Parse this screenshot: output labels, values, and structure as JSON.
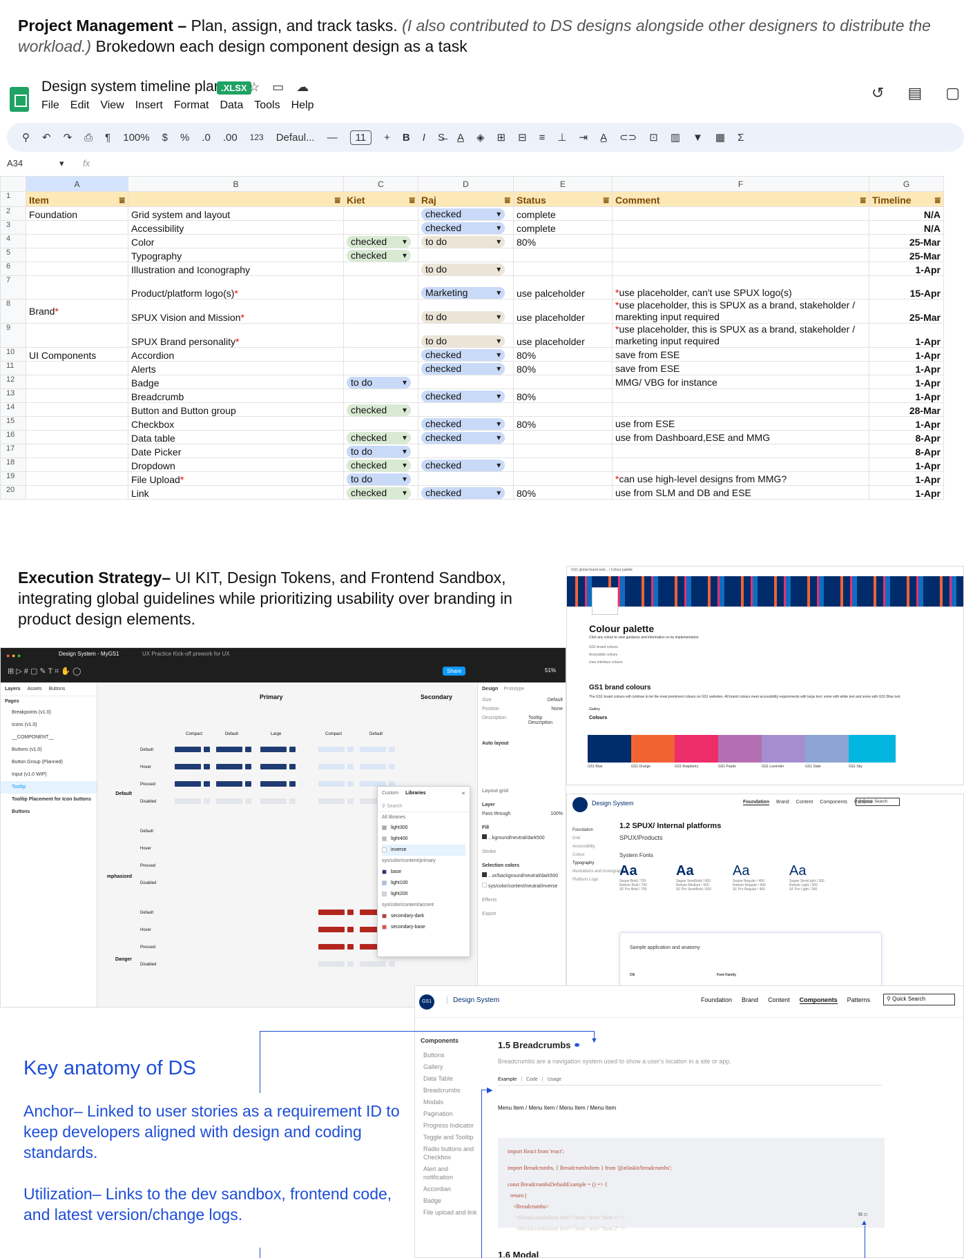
{
  "intro": {
    "bold": "Project Management –",
    "text": " Plan, assign, and track tasks. ",
    "italic": "(I also contributed to DS designs alongside other designers to distribute the workload.)",
    "tail": " Brokedown each design component design as a task"
  },
  "sheet": {
    "title": "Design system timeline plan",
    "badge": ".XLSX",
    "menu": [
      "File",
      "Edit",
      "View",
      "Insert",
      "Format",
      "Data",
      "Tools",
      "Help"
    ],
    "toolbar": {
      "zoom": "100%",
      "currency": "$",
      "percent": "%",
      "dec_dec": ".0",
      "dec_inc": ".00",
      "fmt": "123",
      "font": "Defaul...",
      "font_size": "11",
      "bold": "B",
      "italic": "I"
    },
    "cell_ref": "A34",
    "fx": "fx",
    "columns": [
      "A",
      "B",
      "C",
      "D",
      "E",
      "F",
      "G"
    ],
    "headers": [
      "Item",
      "",
      "Kiet",
      "Raj",
      "Status",
      "Comment",
      "Timeline"
    ],
    "rows": [
      {
        "n": "2",
        "a": "Foundation",
        "b": "Grid system and layout",
        "c": "",
        "d": "checked",
        "e": "complete",
        "f": "",
        "g": "N/A"
      },
      {
        "n": "3",
        "a": "",
        "b": "Accessibility",
        "c": "",
        "d": "checked",
        "e": "complete",
        "f": "",
        "g": "N/A"
      },
      {
        "n": "4",
        "a": "",
        "b": "Color",
        "c": "checked",
        "d": "to do",
        "e": "80%",
        "f": "",
        "g": "25-Mar"
      },
      {
        "n": "5",
        "a": "",
        "b": "Typography",
        "c": "checked",
        "d": "",
        "e": "",
        "f": "",
        "g": "25-Mar"
      },
      {
        "n": "6",
        "a": "",
        "b": "Illustration and Iconography",
        "c": "",
        "d": "to do",
        "e": "",
        "f": "",
        "g": "1-Apr"
      },
      {
        "n": "7",
        "a": "",
        "b": "Product/platform logo(s)",
        "c": "",
        "d": "Marketing",
        "e": "use palceholder",
        "f": "use placeholder, can't use SPUX logo(s)",
        "g": "15-Apr"
      },
      {
        "n": "8",
        "a": "Brand",
        "b": "SPUX Vision and Mission",
        "c": "",
        "d": "to do",
        "e": "use placeholder",
        "f": "use placeholder, this is SPUX as a brand, stakeholder / marekting input required",
        "g": "25-Mar"
      },
      {
        "n": "9",
        "a": "",
        "b": "SPUX Brand personality",
        "c": "",
        "d": "to do",
        "e": "use placeholder",
        "f": "use placeholder, this is SPUX as a brand, stakeholder / marketing input required",
        "g": "1-Apr"
      },
      {
        "n": "10",
        "a": "UI Components",
        "b": "Accordion",
        "c": "",
        "d": "checked",
        "e": "80%",
        "f": "save from ESE",
        "g": "1-Apr"
      },
      {
        "n": "11",
        "a": "",
        "b": "Alerts",
        "c": "",
        "d": "checked",
        "e": "80%",
        "f": "save from ESE",
        "g": "1-Apr"
      },
      {
        "n": "12",
        "a": "",
        "b": "Badge",
        "c": "to do",
        "d": "",
        "e": "",
        "f": "MMG/ VBG for instance",
        "g": "1-Apr"
      },
      {
        "n": "13",
        "a": "",
        "b": "Breadcrumb",
        "c": "",
        "d": "checked",
        "e": "80%",
        "f": "",
        "g": "1-Apr"
      },
      {
        "n": "14",
        "a": "",
        "b": "Button and Button group",
        "c": "checked",
        "d": "",
        "e": "",
        "f": "",
        "g": "28-Mar"
      },
      {
        "n": "15",
        "a": "",
        "b": "Checkbox",
        "c": "",
        "d": "checked",
        "e": "80%",
        "f": "use from ESE",
        "g": "1-Apr"
      },
      {
        "n": "16",
        "a": "",
        "b": "Data table",
        "c": "checked",
        "d": "checked",
        "e": "",
        "f": "use from Dashboard,ESE and MMG",
        "g": "8-Apr"
      },
      {
        "n": "17",
        "a": "",
        "b": "Date Picker",
        "c": "to do",
        "d": "",
        "e": "",
        "f": "",
        "g": "8-Apr"
      },
      {
        "n": "18",
        "a": "",
        "b": "Dropdown",
        "c": "checked",
        "d": "checked",
        "e": "",
        "f": "",
        "g": "1-Apr"
      },
      {
        "n": "19",
        "a": "",
        "b": "File Upload",
        "c": "to do",
        "d": "",
        "e": "",
        "f": "can use high-level designs from MMG?",
        "g": "1-Apr"
      },
      {
        "n": "20",
        "a": "",
        "b": "Link",
        "c": "checked",
        "d": "checked",
        "e": "80%",
        "f": "use from SLM and DB and ESE",
        "g": "1-Apr"
      }
    ]
  },
  "exec": {
    "bold": "Execution Strategy–",
    "text": " UI KIT, Design Tokens, and Frontend Sandbox, integrating global guidelines while prioritizing usability over branding in product design elements."
  },
  "figma": {
    "tab1": "Design System - MyGS1",
    "tab2": "UX Practice Kick-off prework for UX",
    "share": "Share",
    "zoom": "51%",
    "layers_tabs": [
      "Layers",
      "Assets",
      "Buttons"
    ],
    "pages_label": "Pages",
    "pages": [
      "Breakpoints (v1.0)",
      "Icons (v1.0)",
      "__COMPONENT__",
      "Buttons (v1.0)",
      "Button Group (Planned)",
      "Input (v1.0 WIP)",
      "Tooltip",
      "Tooltip Placement for Icon buttons",
      "Buttons"
    ],
    "primary": "Primary",
    "secondary": "Secondary",
    "sizes": [
      "Compact",
      "Default",
      "Large",
      "Compact",
      "Default"
    ],
    "groups": [
      "Default",
      "mphasized",
      "Danger"
    ],
    "states": [
      "Default",
      "Hover",
      "Pressed",
      "Disabled"
    ],
    "right_tabs": [
      "Design",
      "Prototype"
    ],
    "right_labels": [
      "Size",
      "Position",
      "Description",
      "Auto layout",
      "Layout grid",
      "Layer",
      "Pass through",
      "100%",
      "Fill",
      "...kground/neutral/dark500",
      "Stroke",
      "Selection colors",
      "...or/background/neutral/dark500",
      "sys/color/content/neutral/inverse",
      "Effects",
      "Export"
    ],
    "size_val": "Default",
    "position_val": "None",
    "desc_val": "Tooltip Description",
    "pop": {
      "tabs": [
        "Custom",
        "Libraries"
      ],
      "search": "Search",
      "all": "All libraries",
      "items": [
        "light300",
        "light400",
        "inverse",
        "sys/color/content/primary",
        "base",
        "light100",
        "light200",
        "sys/color/content/accent",
        "secondary-dark",
        "secondary-base"
      ]
    }
  },
  "palette": {
    "breadcrumb": "GS1 global brand web... / Colour palette",
    "title": "Colour palette",
    "desc": "Click any colour to view guidance and information on its implementation.",
    "links": [
      "GS1 brand colours",
      "Accessible colours",
      "User interface colours"
    ],
    "section": "GS1 brand colours",
    "section_desc": "The GS1 brand colours will continue to be the most prominent colours on GS1 websites. All brand colours meet accessibility requirements with large text: some with white text and some with GS1 Blue text.",
    "gallery": "Gallery",
    "colours_label": "Colours",
    "swatches": [
      {
        "name": "GS1 Blue",
        "color": "#002c6c"
      },
      {
        "name": "GS1 Orange",
        "color": "#f26334"
      },
      {
        "name": "GS1 Raspberry",
        "color": "#ee2d6b"
      },
      {
        "name": "GS1 Purple",
        "color": "#b36fb1"
      },
      {
        "name": "GS1 Lavender",
        "color": "#a58ed0"
      },
      {
        "name": "GS1 Slate",
        "color": "#8da4d3"
      },
      {
        "name": "GS1 Sky",
        "color": "#00b6de"
      }
    ]
  },
  "spux": {
    "brand": "Design System",
    "nav": [
      "Foundation",
      "Brand",
      "Content",
      "Components",
      "Patterns"
    ],
    "search": "Quick Search",
    "side": [
      "Foundation",
      "Grid",
      "Accessibility",
      "Colour",
      "Typography",
      "Illustrations and Iconography",
      "Platform Logo"
    ],
    "heading": "1.2 SPUX/ Internal platforms",
    "sub": "SPUX/Products",
    "fonts_label": "System Fonts",
    "fonts": [
      {
        "aa": "Aa",
        "l1": "Segoe Bold / 700",
        "l2": "Roboto Bold / 700",
        "l3": "SF Pro Bold / 700"
      },
      {
        "aa": "Aa",
        "l1": "Segoe SemiBold / 600",
        "l2": "Roboto Medium / 500",
        "l3": "SF Pro SemiBold / 600"
      },
      {
        "aa": "Aa",
        "l1": "Segoe Regular / 400",
        "l2": "Roboto Regular / 400",
        "l3": "SF Pro Regular / 400"
      },
      {
        "aa": "Aa",
        "l1": "Segoe SemiLight / 300",
        "l2": "Roboto Light / 300",
        "l3": "SF Pro Light / 300"
      }
    ],
    "sample": "Sample application and anatomy",
    "os": "OS",
    "font_family": "Font Family"
  },
  "site": {
    "logo": "GS1",
    "brand": "Design System",
    "nav": [
      "Foundation",
      "Brand",
      "Content",
      "Components",
      "Patterns"
    ],
    "search": "Quick Search",
    "side_title": "Components",
    "side": [
      "Buttons",
      "Gallery",
      "Data Table",
      "Breadcrumbs",
      "Modals",
      "Pagination",
      "Progress Indicator",
      "Toggle and Tooltip",
      "Radio buttons and Checkbox",
      "Alert and notification",
      "Accordian",
      "Badge",
      "File upload and link"
    ],
    "heading": "1.5 Breadcrumbs",
    "desc": "Breadcrumbs are a navigation system used to show a user's location in a site or app.",
    "tabs": [
      "Example",
      "Code",
      "Usage"
    ],
    "crumbs": "Menu Item  / Menu Item  / Menu Item  / Menu Item",
    "code": [
      "import React from 'react';",
      "import Breadcrumbs, { BreadcrumbsItem } from '@atlaskit/breadcrumbs';",
      "const BreadcrumbsDefaultExample = () => {",
      "  return (",
      "    <Breadcrumbs>",
      "      <BreadcrumbsItem href=\"/item\" text=\"Item 1\" />",
      "      <BreadcrumbsItem href=\"/item\" text=\"Item 2\" />"
    ],
    "next": "1.6 Modal"
  },
  "anatomy": {
    "title": "Key anatomy of DS",
    "p1": "Anchor– Linked to user stories as a requirement ID to keep developers aligned with design and coding standards.",
    "p2": "Utilization– Links to the dev sandbox, frontend code, and latest version/change logs."
  }
}
